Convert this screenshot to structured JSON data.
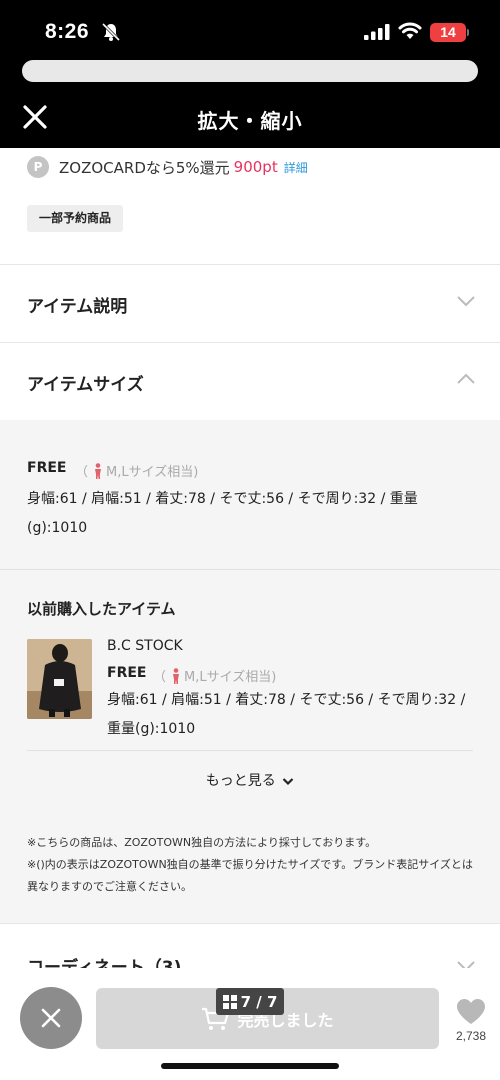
{
  "status_bar": {
    "time": "8:26",
    "battery": "14"
  },
  "header": {
    "title": "拡大・縮小"
  },
  "points": {
    "badge": "P",
    "text": "ZOZOCARDなら5%還元",
    "value": "900pt",
    "detail_link": "詳細"
  },
  "tag": {
    "label": "一部予約商品"
  },
  "sections": {
    "description": "アイテム説明",
    "size": "アイテムサイズ",
    "coordinate": "コーディネート（3)"
  },
  "size_info": {
    "name": "FREE",
    "note_open": "（",
    "note": "M,Lサイズ相当)",
    "detail": "身幅:61 / 肩幅:51 / 着丈:78 / そで丈:56 / そで周り:32 / 重量(g):1010"
  },
  "previous": {
    "heading": "以前購入したアイテム",
    "brand": "B.C STOCK",
    "size_name": "FREE",
    "size_note_open": "（",
    "size_note": "M,Lサイズ相当)",
    "detail": "身幅:61 / 肩幅:51 / 着丈:78 / そで丈:56 / そで周り:32 / 重量(g):1010",
    "more": "もっと見る"
  },
  "notes": [
    "※こちらの商品は、ZOZOTOWN独自の方法により採寸しております。",
    "※()内の表示はZOZOTOWN独自の基準で振り分けたサイズです。ブランド表記サイズとは異なりますのでご注意ください。"
  ],
  "bottom": {
    "soldout_label": "完売しました",
    "page_indicator": "7 / 7",
    "favorites_count": "2,738"
  },
  "colors": {
    "points_value": "#e6335d",
    "detail_link": "#2b9adb",
    "battery": "#ee4040"
  }
}
